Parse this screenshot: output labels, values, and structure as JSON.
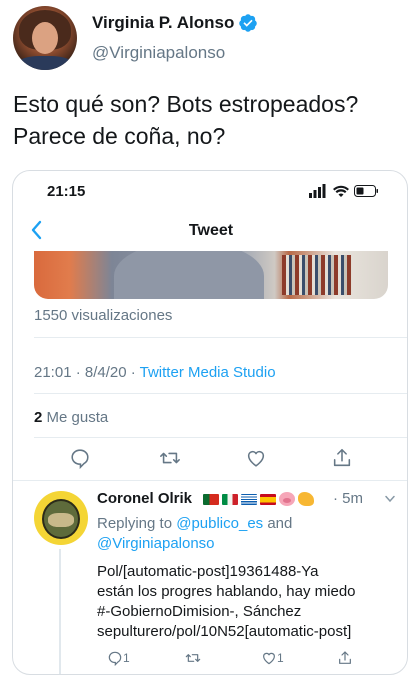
{
  "outer_tweet": {
    "display_name": "Virginia P.  Alonso",
    "handle": "@Virginiapalonso",
    "text_line1": "Esto qué son? Bots estropeados?",
    "text_line2": "Parece de coña, no?"
  },
  "embed": {
    "status_time": "21:15",
    "nav_title": "Tweet",
    "views": "1550 visualizaciones",
    "timestamp": "21:01 · 8/4/20 · ",
    "source": "Twitter Media Studio",
    "likes_count": "2",
    "likes_label": " Me gusta",
    "reply": {
      "name": "Coronel Olrik",
      "time": "· 5m",
      "replying_prefix": "Replying to ",
      "mention1": "@publico_es",
      "and_text": " and",
      "mention2": "@Virginiapalonso",
      "body_line1": "Pol/[automatic-post]19361488-Ya",
      "body_line2": "están los progres hablando, hay miedo",
      "body_line3": "#-GobiernoDimision-, Sánchez",
      "body_line4": "sepulturero/pol/10N52[automatic-post]",
      "reply_count": "1",
      "like_count": "1"
    }
  },
  "colors": {
    "accent": "#1da1f2",
    "secondary_text": "#657786",
    "primary_text": "#14171a"
  },
  "icons": [
    "verified-icon",
    "back-chevron-icon",
    "signal-icon",
    "wifi-icon",
    "battery-icon",
    "reply-icon",
    "retweet-icon",
    "like-icon",
    "share-icon",
    "chevron-down-icon"
  ]
}
